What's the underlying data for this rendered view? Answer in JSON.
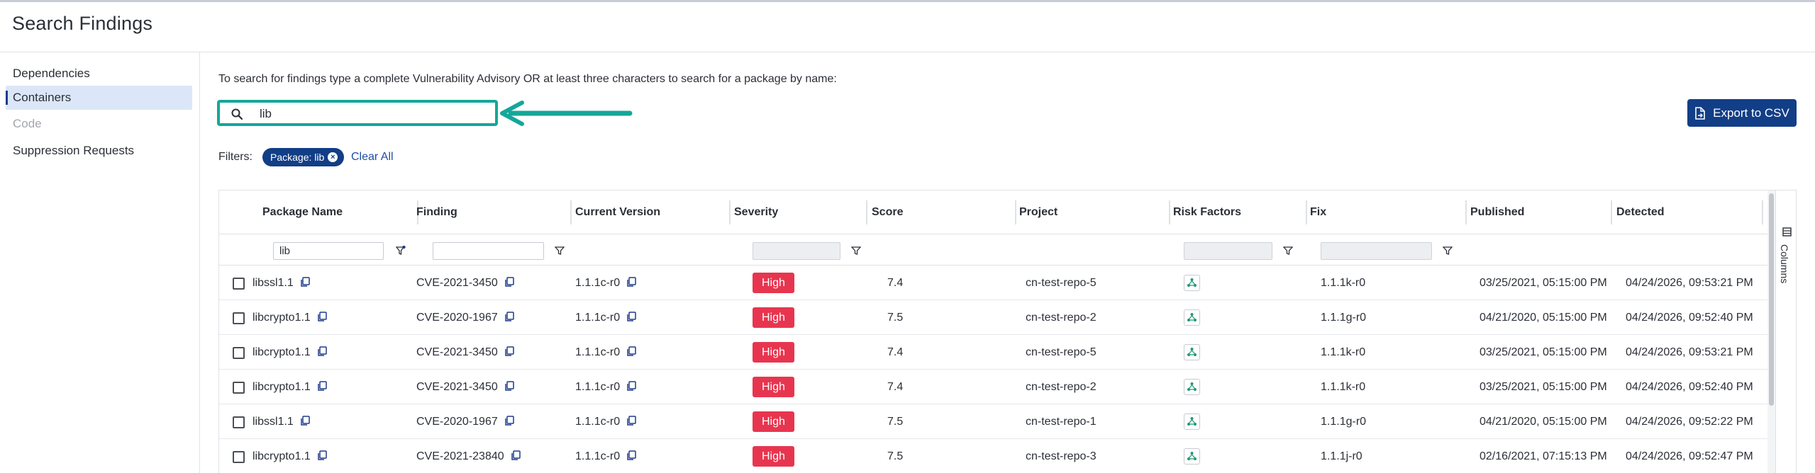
{
  "page_title": "Search Findings",
  "sidebar": {
    "items": [
      {
        "label": "Dependencies",
        "state": "normal"
      },
      {
        "label": "Containers",
        "state": "active"
      },
      {
        "label": "Code",
        "state": "disabled"
      },
      {
        "label": "Suppression Requests",
        "state": "normal"
      }
    ]
  },
  "instructions": "To search for findings type a complete Vulnerability Advisory OR at least three characters to search for a package by name:",
  "search": {
    "value": "lib",
    "icon": "search-icon"
  },
  "export_button": {
    "label": "Export to CSV",
    "icon": "export-file-icon"
  },
  "filters": {
    "label": "Filters:",
    "chips": [
      {
        "label": "Package: lib"
      }
    ],
    "clear_all": "Clear All"
  },
  "table": {
    "columns": [
      "Package Name",
      "Finding",
      "Current Version",
      "Severity",
      "Score",
      "Project",
      "Risk Factors",
      "Fix",
      "Published",
      "Detected"
    ],
    "filter_values": {
      "package_name": "lib",
      "finding": ""
    },
    "rows": [
      {
        "package": "libssl1.1",
        "finding": "CVE-2021-3450",
        "version": "1.1.1c-r0",
        "severity": "High",
        "score": "7.4",
        "project": "cn-test-repo-5",
        "fix": "1.1.1k-r0",
        "published": "03/25/2021, 05:15:00 PM",
        "detected": "04/24/2026, 09:53:21 PM"
      },
      {
        "package": "libcrypto1.1",
        "finding": "CVE-2020-1967",
        "version": "1.1.1c-r0",
        "severity": "High",
        "score": "7.5",
        "project": "cn-test-repo-2",
        "fix": "1.1.1g-r0",
        "published": "04/21/2020, 05:15:00 PM",
        "detected": "04/24/2026, 09:52:40 PM"
      },
      {
        "package": "libcrypto1.1",
        "finding": "CVE-2021-3450",
        "version": "1.1.1c-r0",
        "severity": "High",
        "score": "7.4",
        "project": "cn-test-repo-5",
        "fix": "1.1.1k-r0",
        "published": "03/25/2021, 05:15:00 PM",
        "detected": "04/24/2026, 09:53:21 PM"
      },
      {
        "package": "libcrypto1.1",
        "finding": "CVE-2021-3450",
        "version": "1.1.1c-r0",
        "severity": "High",
        "score": "7.4",
        "project": "cn-test-repo-2",
        "fix": "1.1.1k-r0",
        "published": "03/25/2021, 05:15:00 PM",
        "detected": "04/24/2026, 09:52:40 PM"
      },
      {
        "package": "libssl1.1",
        "finding": "CVE-2020-1967",
        "version": "1.1.1c-r0",
        "severity": "High",
        "score": "7.5",
        "project": "cn-test-repo-1",
        "fix": "1.1.1g-r0",
        "published": "04/21/2020, 05:15:00 PM",
        "detected": "04/24/2026, 09:52:22 PM"
      },
      {
        "package": "libcrypto1.1",
        "finding": "CVE-2021-23840",
        "version": "1.1.1c-r0",
        "severity": "High",
        "score": "7.5",
        "project": "cn-test-repo-3",
        "fix": "1.1.1j-r0",
        "published": "02/16/2021, 07:15:13 PM",
        "detected": "04/24/2026, 09:52:47 PM"
      }
    ]
  },
  "columns_panel": {
    "label": "Columns"
  },
  "colors": {
    "brand": "#123e87",
    "highlight": "#14a79a",
    "severity_high": "#e8354f",
    "risk_icon": "#1f9a72"
  }
}
